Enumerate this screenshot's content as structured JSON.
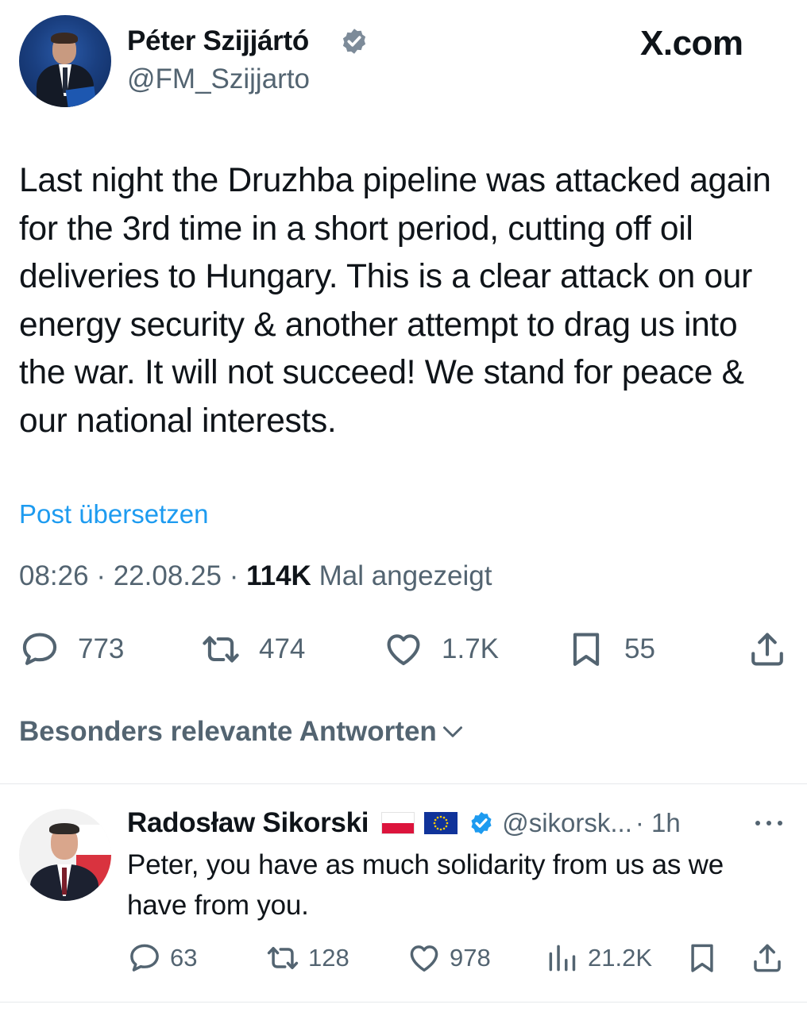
{
  "site": {
    "brand": "X.com"
  },
  "post": {
    "author_name": "Péter Szijjártó",
    "author_handle": "@FM_Szijjarto",
    "text": "Last night the Druzhba pipeline was attacked again for the 3rd time in a short period, cutting off oil deliveries to Hungary. This is a clear attack on our energy security & another attempt to drag us into the war. It will not succeed! We stand for peace & our national interests.",
    "translate_label": "Post übersetzen",
    "time": "08:26",
    "date": "22.08.25",
    "views_count": "114K",
    "views_label": "Mal angezeigt",
    "separator": "·",
    "actions": {
      "replies": "773",
      "reposts": "474",
      "likes": "1.7K",
      "bookmarks": "55"
    }
  },
  "replies_sort": {
    "label": "Besonders relevante Antworten"
  },
  "reply": {
    "author_name": "Radosław Sikorski",
    "author_handle": "@sikorsk...",
    "time_ago": "· 1h",
    "text": "Peter, you have as much solidarity from us as we have from you.",
    "actions": {
      "replies": "63",
      "reposts": "128",
      "likes": "978",
      "views": "21.2K"
    }
  },
  "colors": {
    "text": "#0f1419",
    "secondary": "#536471",
    "link": "#1d9bf0",
    "verified": "#1d9bf0",
    "divider": "#e6e9ec"
  },
  "icons": [
    "verified-badge-icon",
    "reply-icon",
    "repost-icon",
    "like-icon",
    "bookmark-icon",
    "share-icon",
    "chevron-down-icon",
    "more-icon",
    "views-icon"
  ]
}
